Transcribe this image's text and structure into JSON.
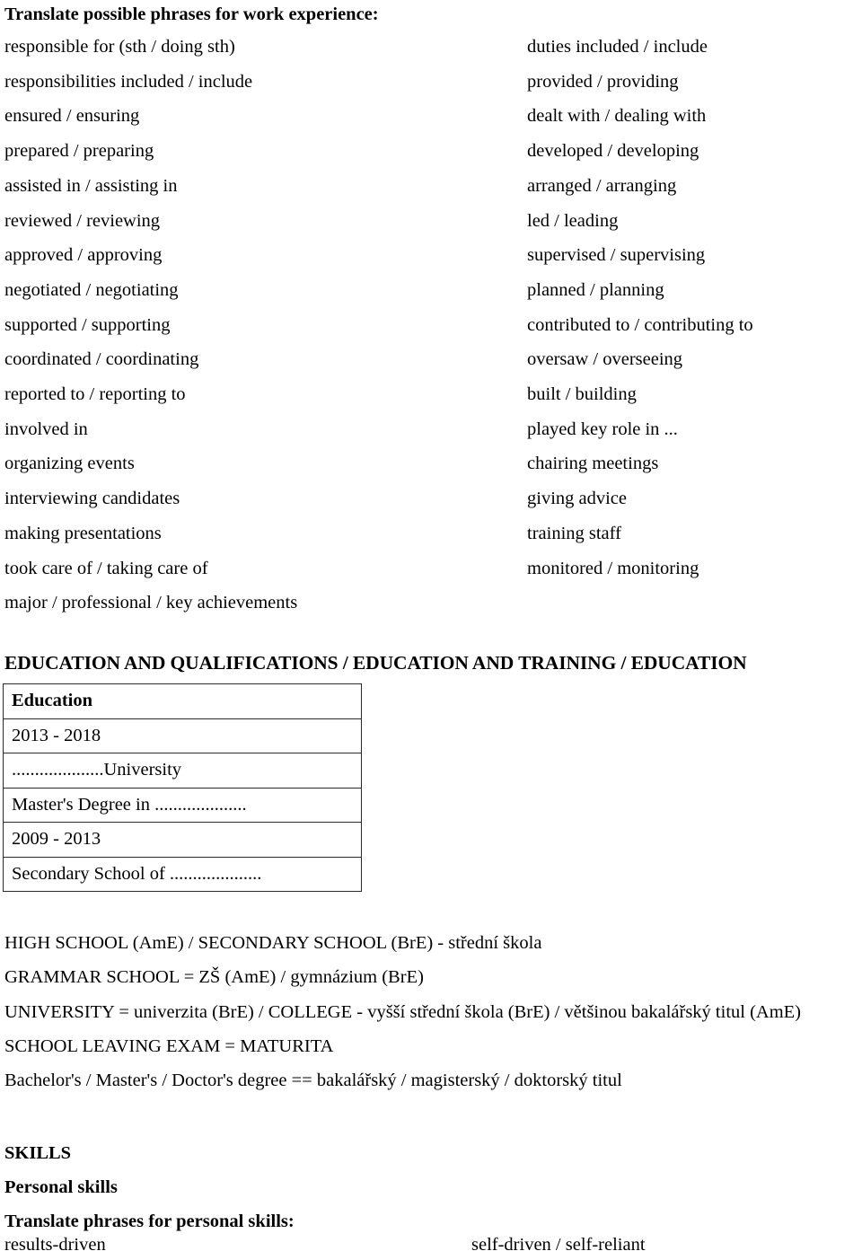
{
  "document": {
    "phrases_section": {
      "title": "Translate possible phrases for work experience:",
      "rows": [
        {
          "left": "responsible for (sth / doing sth)",
          "right": "duties included / include"
        },
        {
          "left": "responsibilities included / include",
          "right": "provided / providing"
        },
        {
          "left": "ensured / ensuring",
          "right": "dealt with / dealing with"
        },
        {
          "left": "prepared / preparing",
          "right": "developed / developing"
        },
        {
          "left": "assisted in / assisting in",
          "right": "arranged / arranging"
        },
        {
          "left": "reviewed / reviewing",
          "right": "led / leading"
        },
        {
          "left": "approved / approving",
          "right": "supervised / supervising"
        },
        {
          "left": "negotiated / negotiating",
          "right": "planned / planning"
        },
        {
          "left": "supported / supporting",
          "right": "contributed to / contributing to"
        },
        {
          "left": "coordinated / coordinating",
          "right": "oversaw / overseeing"
        },
        {
          "left": "reported to / reporting to",
          "right": "built / building"
        },
        {
          "left": "involved in",
          "right": "played key role in ..."
        },
        {
          "left": "organizing events",
          "right": "chairing meetings"
        },
        {
          "left": "interviewing candidates",
          "right": "giving advice"
        },
        {
          "left": "making presentations",
          "right": "training staff"
        },
        {
          "left": "took care of / taking care of",
          "right": "monitored / monitoring"
        },
        {
          "left": "major / professional / key achievements",
          "right": ""
        }
      ]
    },
    "education_section": {
      "heading": "EDUCATION AND QUALIFICATIONS / EDUCATION AND TRAINING / EDUCATION",
      "table_rows": [
        "Education",
        "2013 - 2018",
        "....................University",
        "Master's Degree in ....................",
        "2009 - 2013",
        "Secondary School of ...................."
      ],
      "glossary": [
        "HIGH SCHOOL (AmE) / SECONDARY SCHOOL (BrE) - střední škola",
        "GRAMMAR SCHOOL = ZŠ (AmE) / gymnázium (BrE)",
        "UNIVERSITY = univerzita (BrE) / COLLEGE - vyšší střední škola (BrE) / většinou bakalářský titul (AmE)",
        "SCHOOL LEAVING EXAM = MATURITA",
        "Bachelor's / Master's / Doctor's degree == bakalářský / magisterský / doktorský titul"
      ]
    },
    "skills_section": {
      "heading": "SKILLS",
      "subheading": "Personal skills",
      "instruction": "Translate phrases for personal skills:",
      "rows": [
        {
          "left": "results-driven",
          "right": "self-driven / self-reliant"
        }
      ]
    }
  }
}
